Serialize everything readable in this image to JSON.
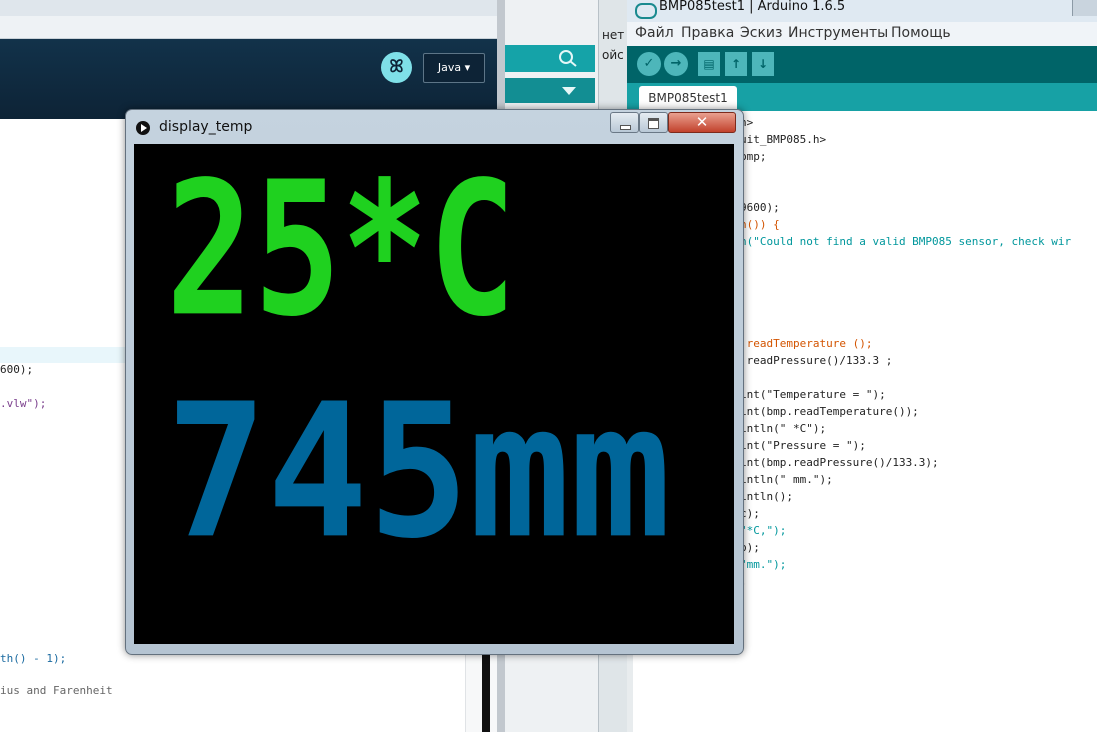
{
  "processing_ide": {
    "mode_button": "ꕤ",
    "mode_dropdown": "Java ▾",
    "code_lines": [
      {
        "text": "600);"
      },
      {
        "text": ".vlw\");"
      },
      {
        "text": "th() - 1);"
      },
      {
        "text": "ius and Farenheit"
      }
    ]
  },
  "middle_strip": {
    "partial_text_1": "нет",
    "partial_text_2": "ойс"
  },
  "arduino_ide": {
    "window_title": "BMP085test1 | Arduino 1.6.5",
    "menu": [
      "Файл",
      "Правка",
      "Эскиз",
      "Инструменты",
      "Помощь"
    ],
    "toolbar": {
      "verify_icon": "✓",
      "upload_icon": "→",
      "new_icon": "▤",
      "open_icon": "↑",
      "save_icon": "↓"
    },
    "tab_label": "BMP085test1",
    "code_lines": [
      "h>",
      "uit_BMP085.h>",
      "bmp;",
      "",
      "",
      "9600);",
      "n()) {",
      "n(\"Could not find a valid BMP085 sensor, check wir",
      "",
      "",
      "",
      "",
      "",
      ".readTemperature ();",
      ".readPressure()/133.3 ;",
      "",
      "int(\"Temperature = \");",
      "int(bmp.readTemperature());",
      "intln(\" *C\");",
      "int(\"Pressure = \");",
      "int(bmp.readPressure()/133.3);",
      "intln(\" mm.\");",
      "intln();",
      "c);",
      "\"*C,\");",
      "p);",
      "\"mm.\");",
      ";"
    ]
  },
  "display_window": {
    "title": "display_temp",
    "close_icon": "✕",
    "temperature_text": "25*C",
    "pressure_text": "745mm",
    "colors": {
      "temperature": "#1fd11f",
      "pressure": "#00669a",
      "background": "#000000"
    }
  }
}
